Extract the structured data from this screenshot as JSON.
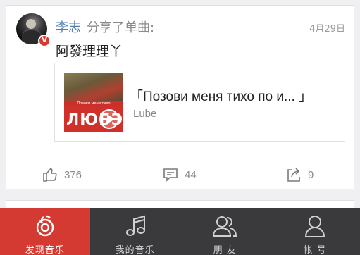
{
  "post": {
    "username": "李志",
    "action_text": "分享了单曲:",
    "date": "4月29日",
    "text": "阿發理理丫",
    "verified_badge": "V"
  },
  "song": {
    "title": "「Позови меня тихо по и... 」",
    "artist": "Lube",
    "cover_logo": "ЛЮБЭ",
    "cover_strip": "Позови меня тихо"
  },
  "actions": {
    "likes": "376",
    "comments": "44",
    "shares": "9"
  },
  "tabs": [
    {
      "label": "发现音乐",
      "icon": "netease-music-icon",
      "active": true
    },
    {
      "label": "我的音乐",
      "icon": "music-note-icon",
      "active": false
    },
    {
      "label": "朋 友",
      "icon": "friends-icon",
      "active": false
    },
    {
      "label": "帐 号",
      "icon": "account-icon",
      "active": false
    }
  ],
  "colors": {
    "accent": "#d43a31",
    "username": "#4f7cb0",
    "tabbar": "#3a3a3c"
  }
}
